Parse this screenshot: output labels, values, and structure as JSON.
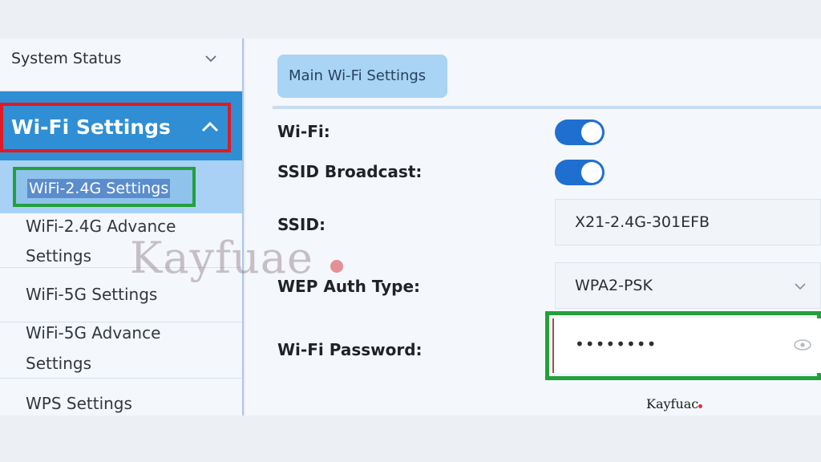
{
  "sidebar": {
    "system_status": "System Status",
    "wifi_settings": "Wi-Fi Settings",
    "active_sub": "WiFi-2.4G Settings",
    "items": [
      {
        "line1": "WiFi-2.4G Advance",
        "line2": "Settings"
      },
      {
        "line1": "WiFi-5G Settings",
        "line2": ""
      },
      {
        "line1": "WiFi-5G Advance",
        "line2": "Settings"
      },
      {
        "line1": "WPS Settings",
        "line2": ""
      }
    ]
  },
  "main": {
    "tab": "Main Wi-Fi Settings",
    "fields": {
      "wifi_label": "Wi-Fi:",
      "ssid_broadcast_label": "SSID Broadcast:",
      "ssid_label": "SSID:",
      "ssid_value": "X21-2.4G-301EFB",
      "auth_label": "WEP Auth Type:",
      "auth_value": "WPA2-PSK",
      "password_label": "Wi-Fi Password:",
      "password_value": "••••••••"
    },
    "toggles": {
      "wifi": true,
      "ssid_broadcast": true
    }
  },
  "watermark": {
    "text": "Kayfuae",
    "logo": "Kayfuac"
  },
  "colors": {
    "accent": "#2f8ed4",
    "toggle_on": "#1f6fd1",
    "highlight_red": "#e01a22",
    "highlight_green": "#22a13b"
  },
  "icons": {
    "system_chevron": "chevron-down-icon",
    "wifi_chevron": "chevron-up-icon",
    "auth_chevron": "chevron-down-icon",
    "password_visibility": "eye-icon"
  }
}
